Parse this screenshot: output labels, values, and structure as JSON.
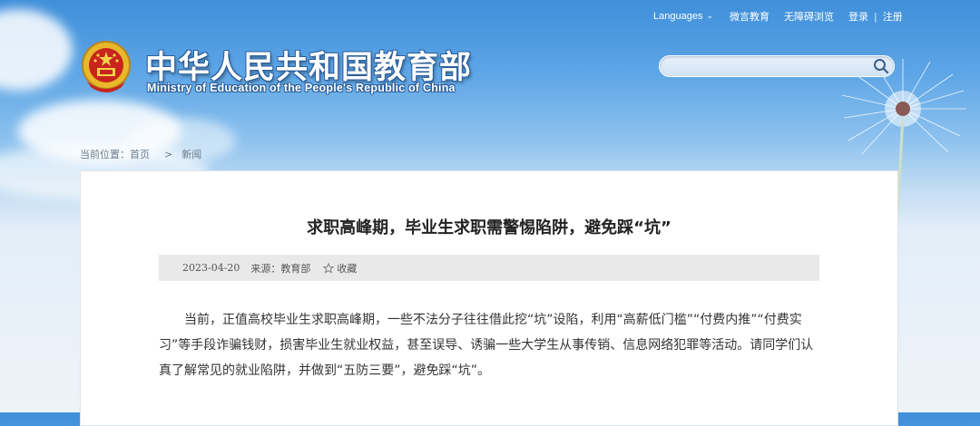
{
  "header": {
    "title_cn": "中华人民共和国教育部",
    "title_en": "Ministry of Education of the People's Republic of China"
  },
  "topnav": {
    "languages": "Languages",
    "wechat": "微言教育",
    "accessible": "无障碍浏览",
    "login": "登录",
    "separator": "|",
    "register": "注册"
  },
  "search": {
    "placeholder": "",
    "value": ""
  },
  "breadcrumb": {
    "label": "当前位置：",
    "home": "首页",
    "arrow": ">",
    "current": "新闻"
  },
  "article": {
    "title": "求职高峰期，毕业生求职需警惕陷阱，避免踩“坑”",
    "date": "2023-04-20",
    "source": "来源：教育部",
    "favorite": "收藏",
    "paragraph": "当前，正值高校毕业生求职高峰期，一些不法分子往往借此挖“坑”设陷，利用“高薪低门槛”“付费内推”“付费实习”等手段诈骗钱财，损害毕业生就业权益，甚至误导、诱骗一些大学生从事传销、信息网络犯罪等活动。请同学们认真了解常见的就业陷阱，并做到“五防三要”，避免踩“坑”。"
  },
  "colors": {
    "sky_top": "#3f8fda",
    "title_stroke": "#2b5e9b",
    "meta_bg": "#e9e9e9"
  }
}
